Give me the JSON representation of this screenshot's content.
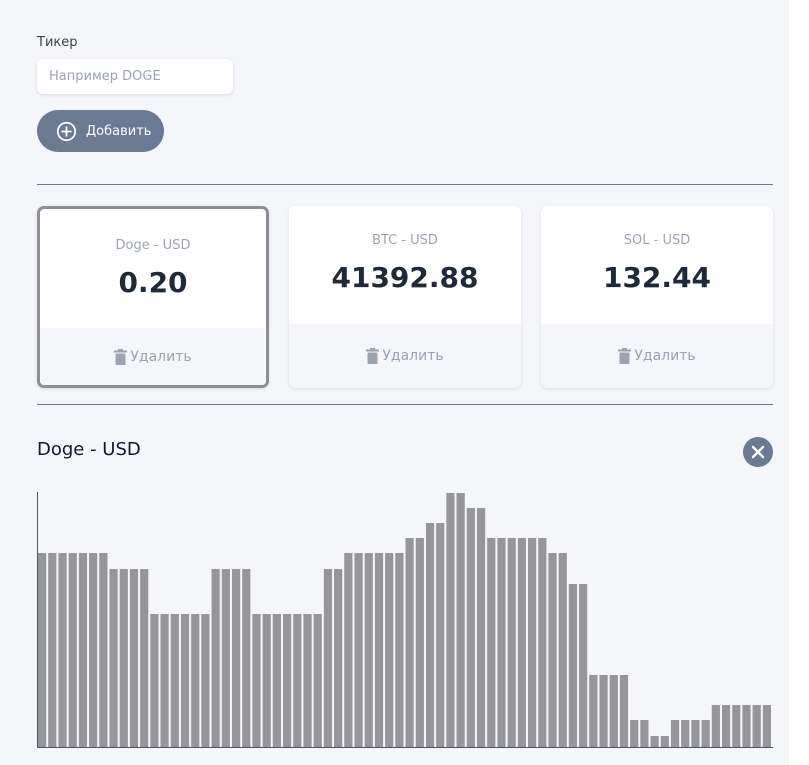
{
  "form": {
    "ticker_label": "Тикер",
    "ticker_placeholder": "Например DOGE",
    "ticker_value": "",
    "add_button_label": "Добавить"
  },
  "tickers": [
    {
      "name": "Doge - USD",
      "price": "0.20",
      "delete_label": "Удалить",
      "selected": true
    },
    {
      "name": "BTC - USD",
      "price": "41392.88",
      "delete_label": "Удалить",
      "selected": false
    },
    {
      "name": "SOL - USD",
      "price": "132.44",
      "delete_label": "Удалить",
      "selected": false
    }
  ],
  "graph": {
    "title": "Doge - USD",
    "close_icon": "close-icon"
  },
  "colors": {
    "accent": "#6b7a93",
    "bar": "#96969a",
    "background": "#f5f6fa"
  },
  "chart_data": {
    "type": "bar",
    "values": [
      194,
      194,
      194,
      194,
      194,
      194,
      194,
      178,
      178,
      178,
      178,
      133,
      133,
      133,
      133,
      133,
      133,
      178,
      178,
      178,
      178,
      133,
      133,
      133,
      133,
      133,
      133,
      133,
      178,
      178,
      194,
      194,
      194,
      194,
      194,
      194,
      209,
      209,
      224,
      224,
      254,
      254,
      239,
      239,
      209,
      209,
      209,
      209,
      209,
      209,
      194,
      194,
      163,
      163,
      72,
      72,
      72,
      72,
      27,
      27,
      11,
      11,
      27,
      27,
      27,
      27,
      42,
      42,
      42,
      42,
      42,
      42
    ],
    "ylim": [
      0,
      254
    ]
  }
}
